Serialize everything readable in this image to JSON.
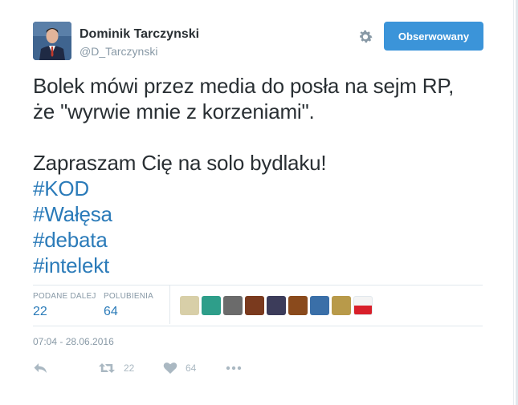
{
  "author": {
    "name": "Dominik Tarczynski",
    "handle": "@D_Tarczynski"
  },
  "follow_button": {
    "label": "Obserwowany"
  },
  "tweet": {
    "lines": [
      "Bolek mówi przez media do posła na sejm RP,",
      "że \"wyrwie mnie z korzeniami\".",
      "",
      "Zapraszam Cię na solo bydlaku!"
    ],
    "hashtags": [
      "#KOD",
      "#Wałęsa",
      "#debata",
      "#intelekt"
    ]
  },
  "stats": {
    "retweets_label": "PODANE DALEJ",
    "retweets_value": "22",
    "likes_label": "POLUBIENIA",
    "likes_value": "64"
  },
  "likers": [
    {
      "color": "#d8cfa8",
      "icon": "owl-avatar"
    },
    {
      "color": "#2e9e8a",
      "icon": "red-swirl-avatar"
    },
    {
      "color": "#6b6b6b",
      "icon": "city-avatar"
    },
    {
      "color": "#7a3a1e",
      "icon": "face-avatar"
    },
    {
      "color": "#3c3c5a",
      "icon": "person-avatar"
    },
    {
      "color": "#8a4a1c",
      "icon": "bear-avatar"
    },
    {
      "color": "#3a6fa8",
      "icon": "person-blue-avatar"
    },
    {
      "color": "#b89a4a",
      "icon": "madonna-avatar"
    },
    {
      "color": "#ffffff",
      "icon": "polish-flag-avatar"
    }
  ],
  "timestamp": "07:04 - 28.06.2016",
  "actions": {
    "reply_icon": "reply-icon",
    "retweet_count": "22",
    "like_count": "64",
    "more_icon": "more-icon"
  }
}
